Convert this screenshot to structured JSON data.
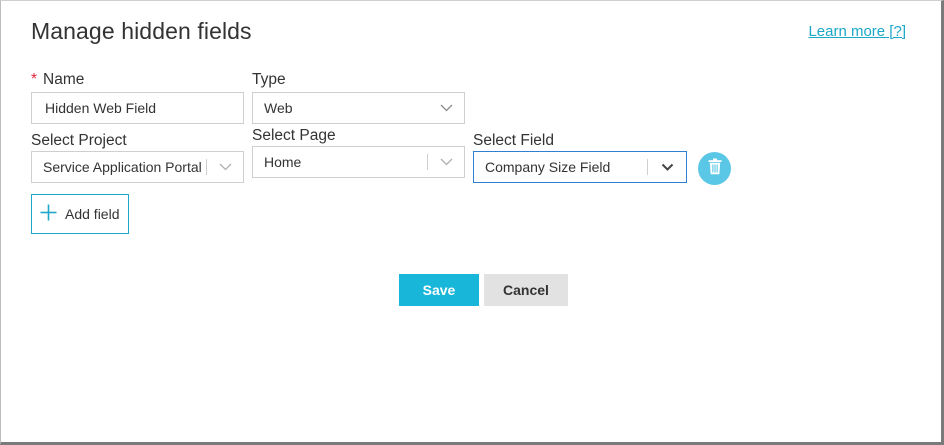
{
  "dialog": {
    "title": "Manage hidden fields",
    "learn_more": "Learn more [?]"
  },
  "form": {
    "name": {
      "required_mark": "*",
      "label": "Name",
      "value": "Hidden Web Field"
    },
    "type": {
      "label": "Type",
      "value": "Web"
    },
    "project": {
      "label": "Select Project",
      "value": "Service Application Portal"
    },
    "page": {
      "label": "Select Page",
      "value": "Home"
    },
    "field": {
      "label": "Select Field",
      "value": "Company Size Field"
    }
  },
  "actions": {
    "add_field": "Add field",
    "save": "Save",
    "cancel": "Cancel"
  },
  "colors": {
    "accent": "#18b6d9",
    "link": "#1ba7c7",
    "required": "#e0263a",
    "focus_border": "#2f7fd3",
    "trash_bg": "#5ac7e6",
    "cancel_bg": "#e2e2e2"
  },
  "icons": {
    "trash": "trash-icon",
    "add": "plus-icon",
    "dropdown": "chevron-down-icon"
  }
}
